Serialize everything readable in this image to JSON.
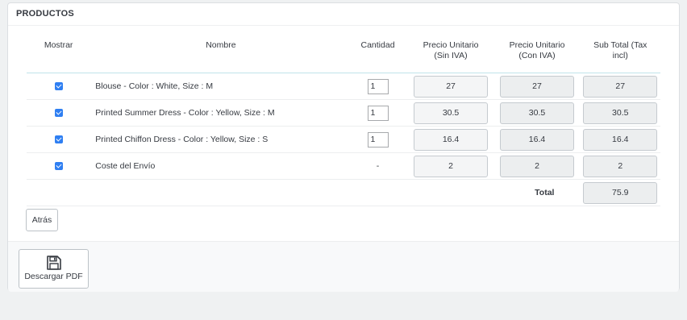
{
  "panel": {
    "title": "PRODUCTOS"
  },
  "table": {
    "headers": {
      "show": "Mostrar",
      "name": "Nombre",
      "qty": "Cantidad",
      "price_ex_line1": "Precio Unitario",
      "price_ex_line2": "(Sin IVA)",
      "price_in_line1": "Precio Unitario",
      "price_in_line2": "(Con IVA)",
      "subtotal_line1": "Sub Total (Tax",
      "subtotal_line2": "incl)"
    },
    "rows": [
      {
        "checked": true,
        "name": "Blouse - Color : White, Size : M",
        "qty": "1",
        "price_ex": "27",
        "price_in": "27",
        "subtotal": "27"
      },
      {
        "checked": true,
        "name": "Printed Summer Dress - Color : Yellow, Size : M",
        "qty": "1",
        "price_ex": "30.5",
        "price_in": "30.5",
        "subtotal": "30.5"
      },
      {
        "checked": true,
        "name": "Printed Chiffon Dress - Color : Yellow, Size : S",
        "qty": "1",
        "price_ex": "16.4",
        "price_in": "16.4",
        "subtotal": "16.4"
      },
      {
        "checked": true,
        "name": "Coste del Envío",
        "qty": "-",
        "price_ex": "2",
        "price_in": "2",
        "subtotal": "2"
      }
    ],
    "total_label": "Total",
    "total_value": "75.9"
  },
  "buttons": {
    "back_label": "Atrás",
    "pdf_label": "Descargar PDF"
  },
  "colors": {
    "checkbox": "#2f7ff2",
    "header_border": "#bfe3ea"
  },
  "icons": {
    "pdf": "floppy-disk-icon",
    "checkbox": "checkbox-checked-icon"
  }
}
